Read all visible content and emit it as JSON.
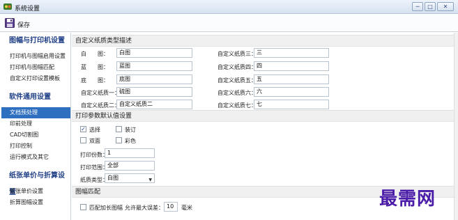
{
  "window": {
    "title": "系统设置",
    "min": "─",
    "max": "□",
    "close": "✕"
  },
  "toolbar": {
    "save_label": "保存"
  },
  "sidebar": {
    "groups": [
      {
        "title": "图幅与打印机设置",
        "items": [
          "打印机与图幅启用设置",
          "打印机与图幅匹配",
          "自定义打印设置模板"
        ]
      },
      {
        "title": "软件通用设置",
        "items": [
          "文档预处理",
          "印前处理",
          "CAD切割图",
          "打印控制",
          "运行模式及其它"
        ]
      },
      {
        "title": "纸张单价与折算设置",
        "items": [
          "纸张单价设置",
          "折算图幅设置"
        ]
      }
    ],
    "active_item": "文档预处理"
  },
  "paper_types": {
    "header": "自定义纸质类型描述",
    "left": [
      {
        "label": "白　　图：",
        "value": "白图"
      },
      {
        "label": "蓝　　图：",
        "value": "蓝图"
      },
      {
        "label": "底　　图：",
        "value": "底图"
      },
      {
        "label": "自定义纸质一：",
        "value": "硫图"
      },
      {
        "label": "自定义纸质二：",
        "value": "自定义纸质二"
      }
    ],
    "right": [
      {
        "label": "自定义纸质三：",
        "value": "三"
      },
      {
        "label": "自定义纸质四：",
        "value": "四"
      },
      {
        "label": "自定义纸质五：",
        "value": "五"
      },
      {
        "label": "自定义纸质六：",
        "value": "六"
      },
      {
        "label": "自定义纸质七：",
        "value": "七"
      }
    ]
  },
  "print_defaults": {
    "header": "打印参数默认值设置",
    "checkboxes": [
      {
        "label": "选择",
        "checked": true
      },
      {
        "label": "装订",
        "checked": false
      },
      {
        "label": "双面",
        "checked": false
      },
      {
        "label": "彩色",
        "checked": false
      }
    ],
    "copies_label": "打印份数：",
    "copies_value": "1",
    "range_label": "打印范围：",
    "range_value": "全部",
    "paper_label": "纸质类型：",
    "paper_value": "白图"
  },
  "frame_match": {
    "header": "图幅匹配",
    "match_label": "匹配加长图幅",
    "match_checked": false,
    "tolerance_label": "允许最大误差：",
    "tolerance_value": "10",
    "tolerance_unit": "毫米"
  },
  "watermark": "最需网"
}
